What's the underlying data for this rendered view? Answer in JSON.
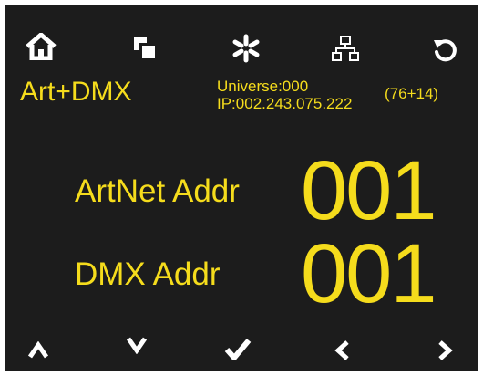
{
  "colors": {
    "background": "#1c1c1c",
    "text": "#f5dc1c",
    "icon": "#ffffff",
    "frame": "#ffffff"
  },
  "toolbar": {
    "icons": [
      "home-icon",
      "copy-icon",
      "asterisk-icon",
      "network-icon",
      "undo-icon"
    ]
  },
  "status": {
    "mode": "Art+DMX",
    "universe": "Universe:000",
    "ip": "IP:002.243.075.222",
    "channels": "(76+14)"
  },
  "fields": [
    {
      "label": "ArtNet Addr",
      "value": "001"
    },
    {
      "label": "DMX Addr",
      "value": "001"
    }
  ],
  "nav": {
    "icons": [
      "up-icon",
      "down-icon",
      "check-icon",
      "left-icon",
      "right-icon"
    ]
  }
}
